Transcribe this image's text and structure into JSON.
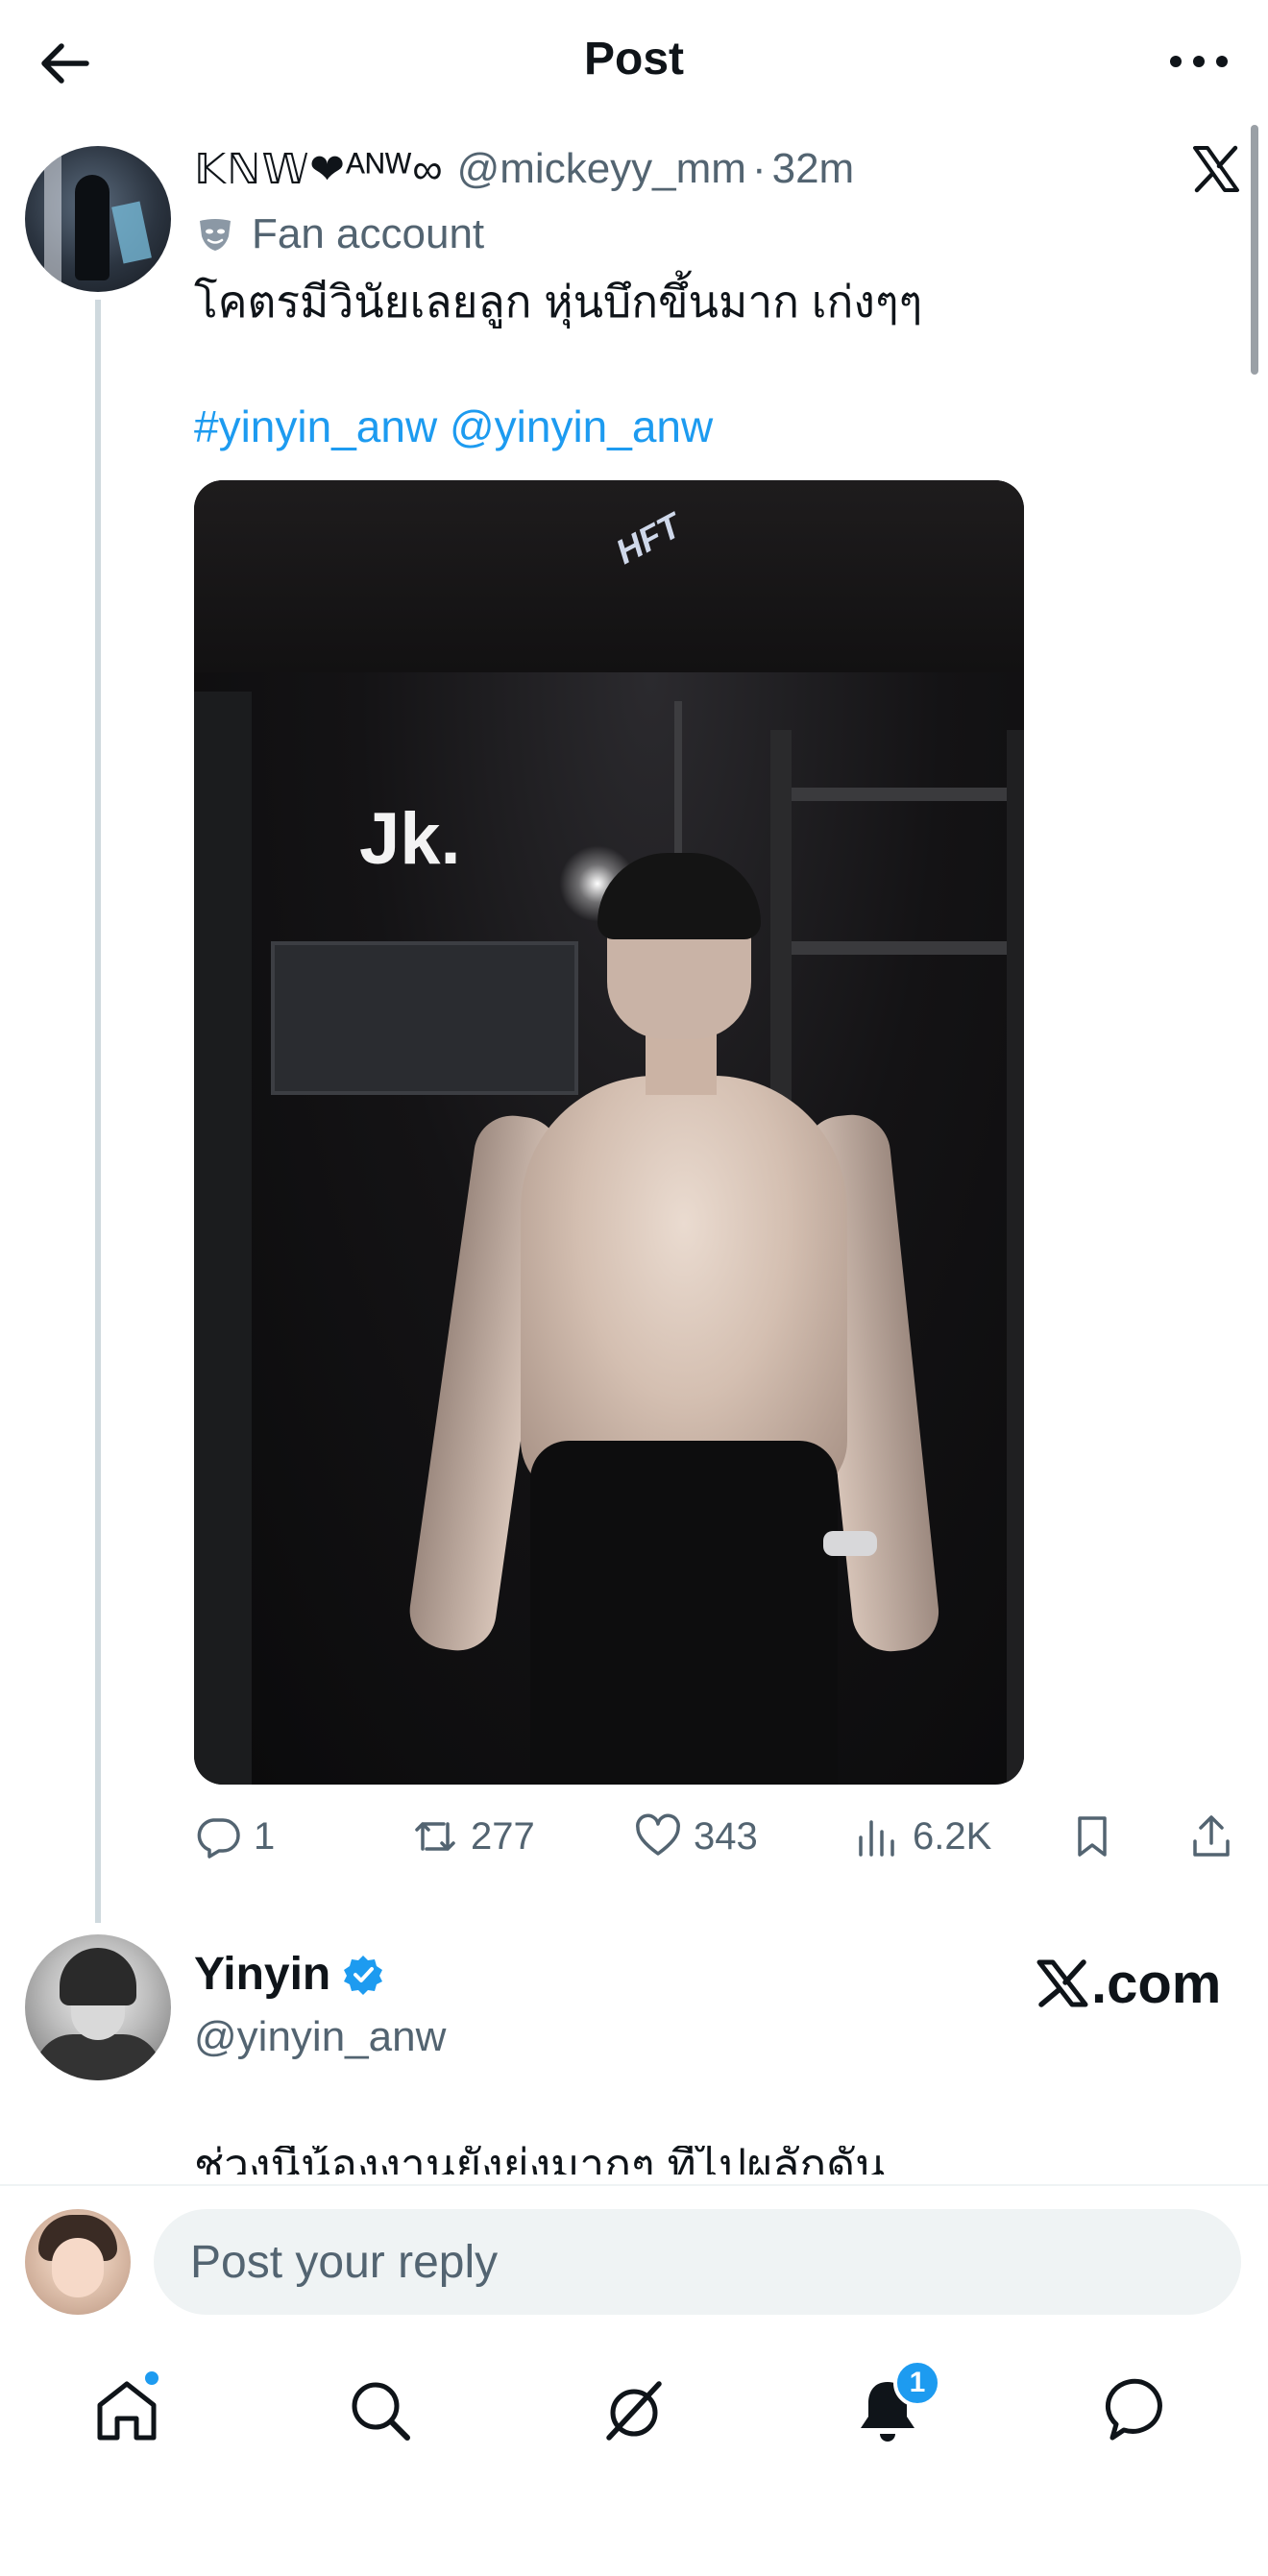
{
  "header": {
    "title": "Post"
  },
  "tweet": {
    "author_name": "𝕂ℕ𝕎❤ᴬᴺᵂ∞",
    "handle": "@mickeyy_mm",
    "separator": "·",
    "time": "32m",
    "label": "Fan account",
    "text": "โคตรมีวินัยเลยลูก หุ่นบึกขึ้นมาก เก่งๆๆ",
    "hashtag": "#yinyin_anw",
    "mention": "@yinyin_anw",
    "media_caption": "Jk.",
    "media_logo": "HFT",
    "stats": {
      "replies": "1",
      "reposts": "277",
      "likes": "343",
      "views": "6.2K"
    }
  },
  "quoted": {
    "name": "Yinyin",
    "handle": "@yinyin_anw",
    "card_brand": ".com",
    "cutoff_text": "ช่วงนี้น้องงานยังยุ่งมากๆ ที่ไปผลักดัน"
  },
  "reply": {
    "placeholder": "Post your reply"
  },
  "nav": {
    "notification_count": "1"
  },
  "colors": {
    "accent": "#1d9bf0",
    "secondary_text": "#536471",
    "primary_text": "#0f1419",
    "input_bg": "#eff3f4",
    "thread_line": "#cfd9de"
  },
  "icons": {
    "back": "arrow-left-icon",
    "more": "more-horizontal-icon",
    "x_logo": "x-logo-icon",
    "fan_account": "mask-icon",
    "reply": "reply-icon",
    "repost": "repost-icon",
    "like": "heart-icon",
    "views": "views-icon",
    "bookmark": "bookmark-icon",
    "share": "share-icon",
    "verified": "verified-badge-icon",
    "home": "home-icon",
    "search": "search-icon",
    "grok": "grok-icon",
    "notifications": "bell-icon",
    "messages": "message-icon"
  }
}
